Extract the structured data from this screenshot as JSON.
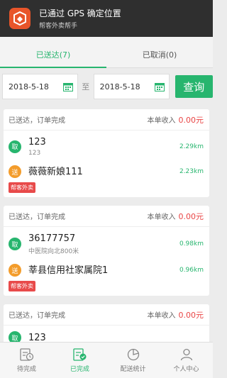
{
  "notification": {
    "title": "已通过 GPS 确定位置",
    "subtitle": "帮客外卖帮手"
  },
  "tabs": [
    {
      "label": "已送达(7)",
      "active": true
    },
    {
      "label": "已取消(0)",
      "active": false
    }
  ],
  "filter": {
    "start_date": "2018-5-18",
    "separator": "至",
    "end_date": "2018-5-18",
    "search_label": "查询"
  },
  "orders": [
    {
      "status": "已送达，订单完成",
      "income_label": "本单收入",
      "income": "0.00元",
      "pickup": {
        "badge": "取",
        "name": "123",
        "address": "123",
        "distance": "2.29km"
      },
      "dropoff": {
        "badge": "送",
        "name": "薇薇新娘111",
        "distance": "2.23km"
      },
      "source": "帮客外卖"
    },
    {
      "status": "已送达，订单完成",
      "income_label": "本单收入",
      "income": "0.00元",
      "pickup": {
        "badge": "取",
        "name": "36177757",
        "address": "中医院向北800米",
        "distance": "0.98km"
      },
      "dropoff": {
        "badge": "送",
        "name": "莘县信用社家属院1",
        "distance": "0.96km"
      },
      "source": "帮客外卖"
    },
    {
      "status": "已送达，订单完成",
      "income_label": "本单收入",
      "income": "0.00元",
      "pickup": {
        "badge": "取",
        "name": "123",
        "address": "",
        "distance": ""
      }
    }
  ],
  "bottom_nav": [
    {
      "label": "待完成",
      "icon": "pending-icon",
      "active": false
    },
    {
      "label": "已完成",
      "icon": "completed-icon",
      "active": true
    },
    {
      "label": "配送统计",
      "icon": "pie-chart-icon",
      "active": false
    },
    {
      "label": "个人中心",
      "icon": "person-icon",
      "active": false
    }
  ],
  "colors": {
    "accent": "#27b56e",
    "income": "#e94545",
    "pickup_badge": "#27b56e",
    "dropoff_badge": "#f39c2b",
    "source_tag": "#e84a4a",
    "notification_bg": "#2f2f2f"
  }
}
